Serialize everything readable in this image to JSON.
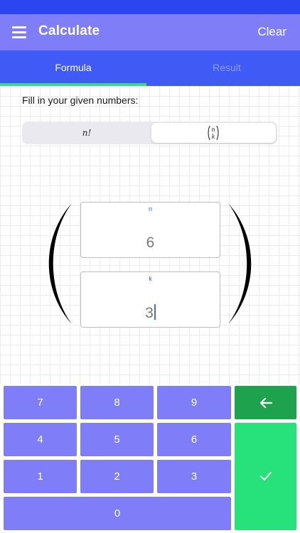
{
  "app": {
    "title": "Calculate",
    "clear_label": "Clear",
    "icons": {
      "menu": "hamburger-menu-icon",
      "backspace": "arrow-left-icon",
      "confirm": "checkmark-icon"
    },
    "colors": {
      "statusbar": "#2b46f0",
      "appbar": "#7f7ef8",
      "tabs": "#3f5af5",
      "tab_indicator": "#34dc86",
      "key": "#7f7ef8",
      "backspace_key": "#1fa24e",
      "confirm_key": "#27e17a"
    }
  },
  "tabs": [
    {
      "label": "Formula",
      "active": true
    },
    {
      "label": "Result",
      "active": false
    }
  ],
  "formula": {
    "instruction": "Fill in your given numbers:",
    "modes": [
      {
        "label": "n!",
        "selected": false
      },
      {
        "label": "binom(n,k)",
        "selected": true
      }
    ],
    "inputs": {
      "n": {
        "label": "n",
        "value": "6"
      },
      "k": {
        "label": "k",
        "value": "3"
      }
    }
  },
  "keypad": {
    "keys": [
      "7",
      "8",
      "9",
      "4",
      "5",
      "6",
      "1",
      "2",
      "3",
      "0"
    ]
  }
}
